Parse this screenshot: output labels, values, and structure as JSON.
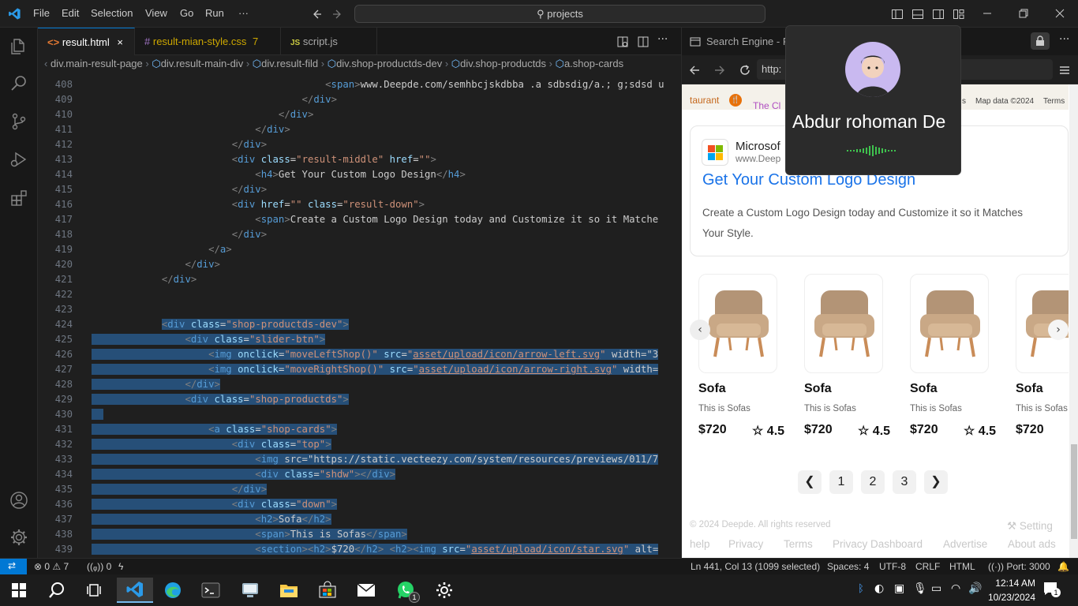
{
  "titlebar": {
    "menu": [
      "File",
      "Edit",
      "Selection",
      "View",
      "Go",
      "Run",
      "···"
    ],
    "search": "projects"
  },
  "tabs": [
    {
      "label": "result.html",
      "icon": "html-icon",
      "active": true,
      "close": "×"
    },
    {
      "label": "result-mian-style.css",
      "badge": "7",
      "icon": "css-icon"
    },
    {
      "label": "script.js",
      "icon": "js-icon"
    }
  ],
  "breadcrumb": [
    "div.main-result-page",
    "div.result-main-div",
    "div.result-fild",
    "div.shop-productds-dev",
    "div.shop-productds",
    "a.shop-cards"
  ],
  "editor_lines": [
    {
      "n": "408",
      "code": "<span>www.Deepde.com/semhbcjskdbba .a sdbsdig/a.; g;sdsd u"
    },
    {
      "n": "409",
      "code": "</div>"
    },
    {
      "n": "410",
      "code": "</div>"
    },
    {
      "n": "411",
      "code": "</div>"
    },
    {
      "n": "412",
      "code": "</div>"
    },
    {
      "n": "413",
      "code": "<div class=\"result-middle\" href=\"\">"
    },
    {
      "n": "414",
      "code": "<h4>Get Your Custom Logo Design</h4>"
    },
    {
      "n": "415",
      "code": "</div>"
    },
    {
      "n": "416",
      "code": "<div href=\"\" class=\"result-down\">"
    },
    {
      "n": "417",
      "code": "<span>Create a Custom Logo Design today and Customize it so it Matche"
    },
    {
      "n": "418",
      "code": "</div>"
    },
    {
      "n": "419",
      "code": "</a>"
    },
    {
      "n": "420",
      "code": "</div>"
    },
    {
      "n": "421",
      "code": "</div>"
    },
    {
      "n": "422",
      "code": ""
    },
    {
      "n": "423",
      "code": ""
    },
    {
      "n": "424",
      "code": "<div class=\"shop-productds-dev\">"
    },
    {
      "n": "425",
      "code": "<div class=\"slider-btn\">"
    },
    {
      "n": "426",
      "code": "<img onclick=\"moveLeftShop()\" src=\"asset/upload/icon/arrow-left.svg\" width=\"3"
    },
    {
      "n": "427",
      "code": "<img onclick=\"moveRightShop()\" src=\"asset/upload/icon/arrow-right.svg\" width="
    },
    {
      "n": "428",
      "code": "</div>"
    },
    {
      "n": "429",
      "code": "<div class=\"shop-productds\">"
    },
    {
      "n": "430",
      "code": ""
    },
    {
      "n": "431",
      "code": "<a class=\"shop-cards\">"
    },
    {
      "n": "432",
      "code": "<div class=\"top\">"
    },
    {
      "n": "433",
      "code": "<img src=\"https://static.vecteezy.com/system/resources/previews/011/7"
    },
    {
      "n": "434",
      "code": "<div class=\"shdw\"></div>"
    },
    {
      "n": "435",
      "code": "</div>"
    },
    {
      "n": "436",
      "code": "<div class=\"down\">"
    },
    {
      "n": "437",
      "code": "<h2>Sofa</h2>"
    },
    {
      "n": "438",
      "code": "<span>This is Sofas</span>"
    },
    {
      "n": "439",
      "code": "<section><h2>$720</h2> <h2><img src=\"asset/upload/icon/star.svg\" alt="
    }
  ],
  "browser": {
    "tab_title": "Search Engine - R",
    "url": "http:",
    "map_labels": {
      "place": "taurant",
      "cl": "The Cl",
      "data": "Map data ©2024",
      "terms": "Terms",
      "s": "s"
    },
    "ad": {
      "advertiser": "Microsof",
      "site": "www.Deep",
      "title": "Get Your Custom Logo Design",
      "desc_line1": "Create a Custom Logo Design today and Customize it so it Matches",
      "desc_line2": "Your Style."
    },
    "products": [
      {
        "name": "Sofa",
        "desc": "This is Sofas",
        "price": "$720",
        "rating": "4.5"
      },
      {
        "name": "Sofa",
        "desc": "This is Sofas",
        "price": "$720",
        "rating": "4.5"
      },
      {
        "name": "Sofa",
        "desc": "This is Sofas",
        "price": "$720",
        "rating": "4.5"
      },
      {
        "name": "Sofa",
        "desc": "This is Sofas",
        "price": "$720",
        "rating": ""
      }
    ],
    "pagination": [
      "1",
      "2",
      "3"
    ],
    "footer": {
      "copyright": "© 2024 Deepde. All rights reserved",
      "setting": "Setting",
      "links": [
        "help",
        "Privacy",
        "Terms",
        "Privacy Dashboard",
        "Advertise",
        "About ads"
      ]
    }
  },
  "call": {
    "name": "Abdur rohoman De"
  },
  "statusbar": {
    "errors": "0",
    "warnings": "7",
    "ports": "0",
    "position": "Ln 441, Col 13 (1099 selected)",
    "spaces": "Spaces: 4",
    "encoding": "UTF-8",
    "eol": "CRLF",
    "language": "HTML",
    "port": "Port: 3000"
  },
  "taskbar": {
    "time": "12:14 AM",
    "date": "10/23/2024",
    "notifications": "1",
    "whatsapp_badge": "1"
  },
  "colors": {
    "accent": "#0078d4",
    "link": "#1a73e8",
    "selection": "#264f78"
  }
}
